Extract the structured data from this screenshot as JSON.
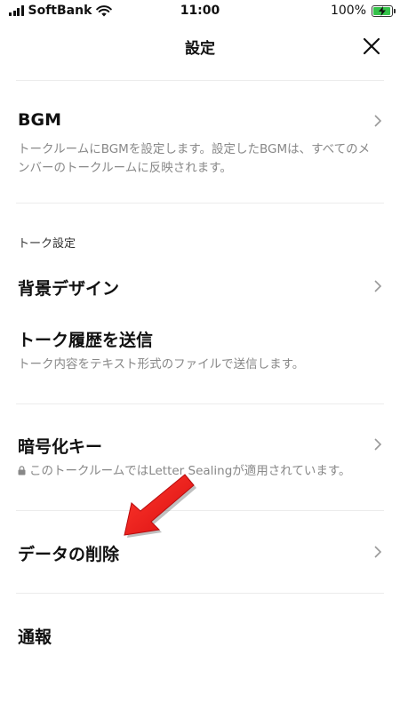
{
  "status_bar": {
    "carrier": "SoftBank",
    "time": "11:00",
    "battery": "100%",
    "battery_level": 1.0
  },
  "header": {
    "title": "設定",
    "close_icon": "close-icon"
  },
  "items": {
    "bgm": {
      "title": "BGM",
      "description": "トークルームにBGMを設定します。設定したBGMは、すべてのメンバーのトークルームに反映されます。"
    },
    "section_label": "トーク設定",
    "background": {
      "title": "背景デザイン"
    },
    "send_history": {
      "title": "トーク履歴を送信",
      "description": "トーク内容をテキスト形式のファイルで送信します。"
    },
    "encryption": {
      "title": "暗号化キー",
      "description": "このトークルームではLetter Sealingが適用されています。"
    },
    "delete_data": {
      "title": "データの削除"
    },
    "report": {
      "title": "通報"
    }
  },
  "colors": {
    "annotation_arrow": "#e8191a",
    "battery_fill": "#35c24a"
  }
}
